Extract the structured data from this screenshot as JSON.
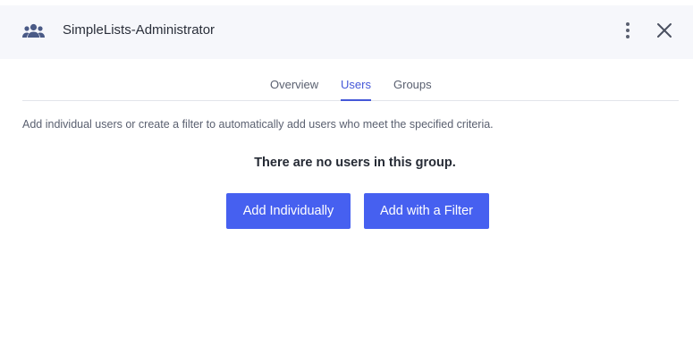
{
  "header": {
    "title": "SimpleLists-Administrator",
    "icon": "group-icon",
    "more_icon": "more-vertical-icon",
    "close_icon": "close-icon"
  },
  "tabs": [
    {
      "label": "Overview",
      "active": false
    },
    {
      "label": "Users",
      "active": true
    },
    {
      "label": "Groups",
      "active": false
    }
  ],
  "users": {
    "description": "Add individual users or create a filter to automatically add users who meet the specified criteria.",
    "empty_message": "There are no users in this group.",
    "add_individually_label": "Add Individually",
    "add_filter_label": "Add with a Filter"
  },
  "colors": {
    "accent": "#4660f0",
    "active_tab": "#4558d8",
    "header_bg": "#f6f7fb",
    "icon": "#4a5a86"
  }
}
